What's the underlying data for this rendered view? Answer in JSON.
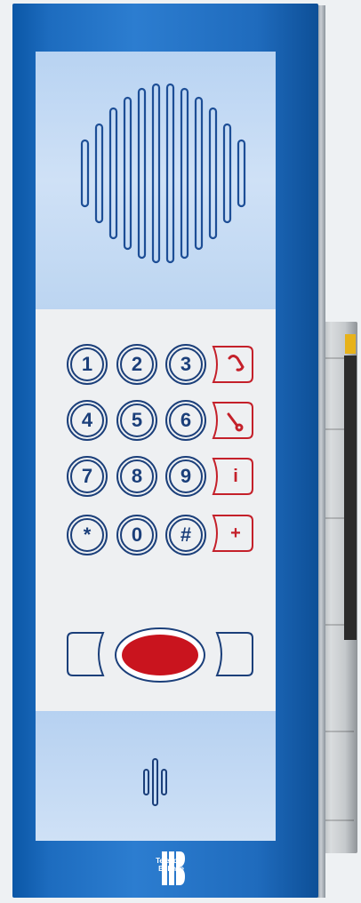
{
  "keypad": {
    "keys": [
      "1",
      "2",
      "3",
      "4",
      "5",
      "6",
      "7",
      "8",
      "9",
      "*",
      "0",
      "#"
    ],
    "function_keys": [
      "pick-up",
      "hang-up",
      "i",
      "+"
    ],
    "function_label_info": "i",
    "function_label_plus": "+"
  },
  "brand": {
    "line1": "Telecom",
    "line2": "Behnke"
  },
  "colors": {
    "panel_blue": "#1d6cbf",
    "key_blue": "#1b3f7a",
    "function_red": "#c4202a",
    "call_button_red": "#c9141e"
  }
}
